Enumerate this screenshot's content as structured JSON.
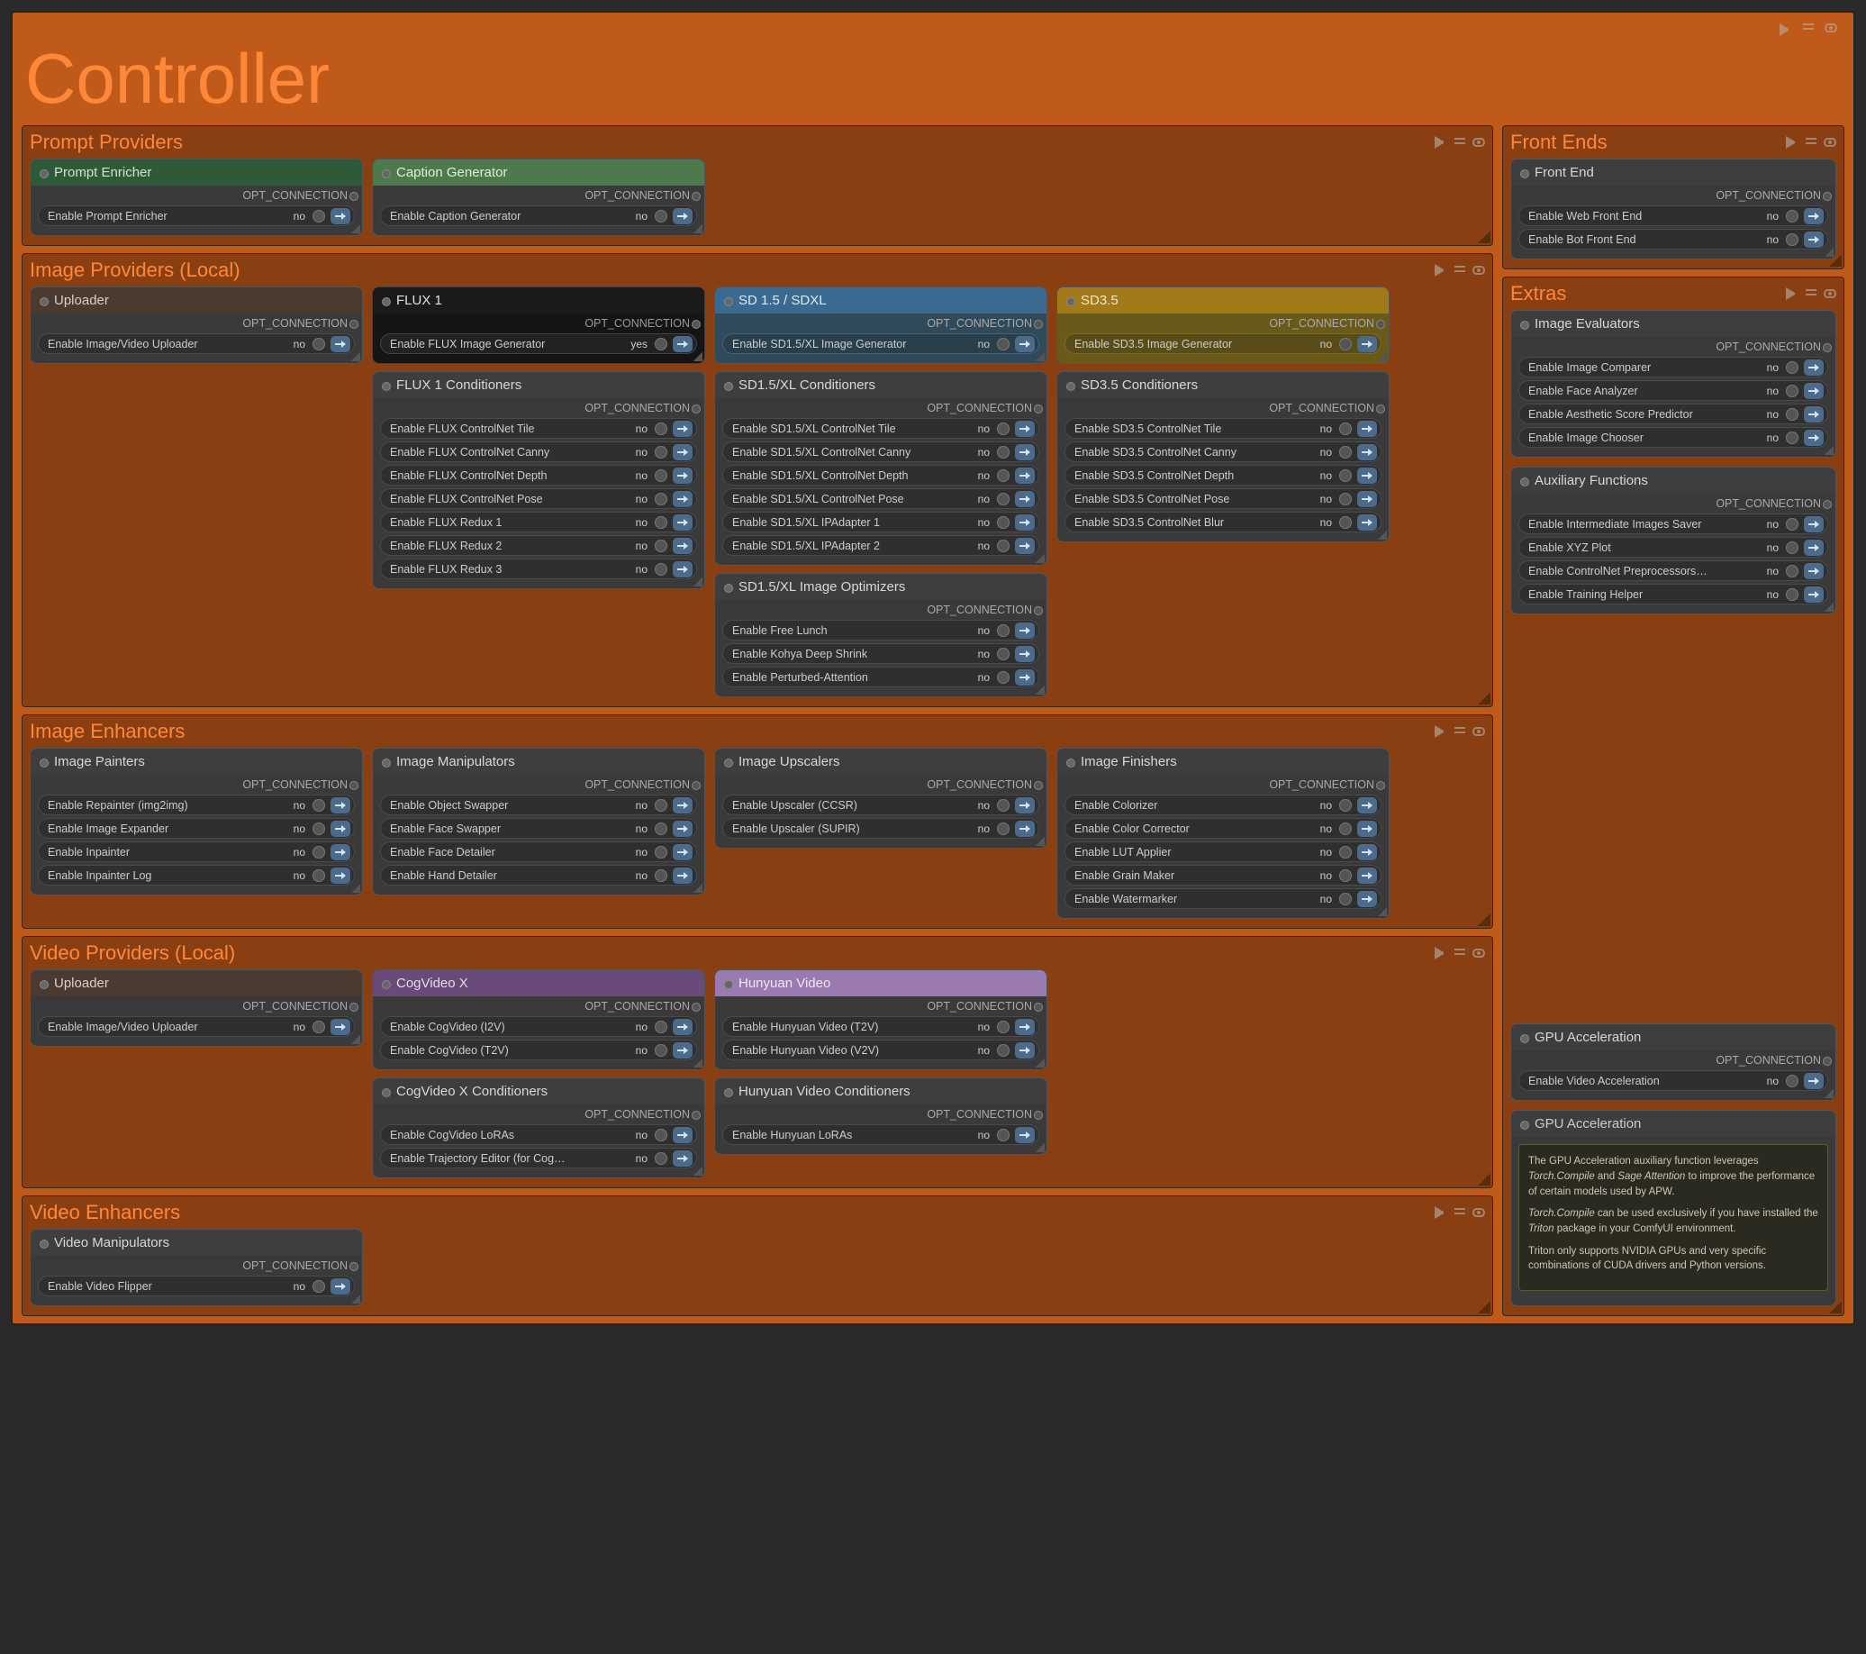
{
  "title": "Controller",
  "opt_label": "OPT_CONNECTION",
  "val_no": "no",
  "val_yes": "yes",
  "sections": {
    "prompt_providers": "Prompt Providers",
    "image_providers": "Image Providers (Local)",
    "image_enhancers": "Image Enhancers",
    "video_providers": "Video Providers (Local)",
    "video_enhancers": "Video Enhancers",
    "front_ends": "Front Ends",
    "extras": "Extras"
  },
  "nodes": {
    "prompt_enricher": {
      "title": "Prompt Enricher",
      "items": [
        {
          "label": "Enable Prompt Enricher",
          "val": "no"
        }
      ]
    },
    "caption_generator": {
      "title": "Caption Generator",
      "items": [
        {
          "label": "Enable Caption Generator",
          "val": "no"
        }
      ]
    },
    "uploader1": {
      "title": "Uploader",
      "items": [
        {
          "label": "Enable Image/Video Uploader",
          "val": "no"
        }
      ]
    },
    "flux1": {
      "title": "FLUX 1",
      "items": [
        {
          "label": "Enable FLUX Image Generator",
          "val": "yes"
        }
      ]
    },
    "flux1_cond": {
      "title": "FLUX 1 Conditioners",
      "items": [
        {
          "label": "Enable FLUX ControlNet Tile",
          "val": "no"
        },
        {
          "label": "Enable FLUX ControlNet Canny",
          "val": "no"
        },
        {
          "label": "Enable FLUX ControlNet Depth",
          "val": "no"
        },
        {
          "label": "Enable FLUX ControlNet Pose",
          "val": "no"
        },
        {
          "label": "Enable FLUX Redux 1",
          "val": "no"
        },
        {
          "label": "Enable FLUX Redux 2",
          "val": "no"
        },
        {
          "label": "Enable FLUX Redux 3",
          "val": "no"
        }
      ]
    },
    "sd15": {
      "title": "SD 1.5 / SDXL",
      "items": [
        {
          "label": "Enable SD1.5/XL Image Generator",
          "val": "no"
        }
      ]
    },
    "sd15_cond": {
      "title": "SD1.5/XL Conditioners",
      "items": [
        {
          "label": "Enable SD1.5/XL ControlNet Tile",
          "val": "no"
        },
        {
          "label": "Enable SD1.5/XL ControlNet Canny",
          "val": "no"
        },
        {
          "label": "Enable SD1.5/XL ControlNet Depth",
          "val": "no"
        },
        {
          "label": "Enable SD1.5/XL ControlNet Pose",
          "val": "no"
        },
        {
          "label": "Enable SD1.5/XL IPAdapter 1",
          "val": "no"
        },
        {
          "label": "Enable SD1.5/XL IPAdapter 2",
          "val": "no"
        }
      ]
    },
    "sd15_opt": {
      "title": "SD1.5/XL Image Optimizers",
      "items": [
        {
          "label": "Enable Free Lunch",
          "val": "no"
        },
        {
          "label": "Enable Kohya Deep Shrink",
          "val": "no"
        },
        {
          "label": "Enable Perturbed-Attention",
          "val": "no"
        }
      ]
    },
    "sd35": {
      "title": "SD3.5",
      "items": [
        {
          "label": "Enable SD3.5 Image Generator",
          "val": "no"
        }
      ]
    },
    "sd35_cond": {
      "title": "SD3.5 Conditioners",
      "items": [
        {
          "label": "Enable SD3.5 ControlNet Tile",
          "val": "no"
        },
        {
          "label": "Enable SD3.5 ControlNet Canny",
          "val": "no"
        },
        {
          "label": "Enable SD3.5 ControlNet Depth",
          "val": "no"
        },
        {
          "label": "Enable SD3.5 ControlNet Pose",
          "val": "no"
        },
        {
          "label": "Enable SD3.5 ControlNet Blur",
          "val": "no"
        }
      ]
    },
    "image_painters": {
      "title": "Image Painters",
      "items": [
        {
          "label": "Enable Repainter (img2img)",
          "val": "no"
        },
        {
          "label": "Enable Image Expander",
          "val": "no"
        },
        {
          "label": "Enable Inpainter",
          "val": "no"
        },
        {
          "label": "Enable Inpainter Log",
          "val": "no"
        }
      ]
    },
    "image_manipulators": {
      "title": "Image Manipulators",
      "items": [
        {
          "label": "Enable Object Swapper",
          "val": "no"
        },
        {
          "label": "Enable Face Swapper",
          "val": "no"
        },
        {
          "label": "Enable Face Detailer",
          "val": "no"
        },
        {
          "label": "Enable Hand Detailer",
          "val": "no"
        }
      ]
    },
    "image_upscalers": {
      "title": "Image Upscalers",
      "items": [
        {
          "label": "Enable Upscaler (CCSR)",
          "val": "no"
        },
        {
          "label": "Enable Upscaler (SUPIR)",
          "val": "no"
        }
      ]
    },
    "image_finishers": {
      "title": "Image Finishers",
      "items": [
        {
          "label": "Enable Colorizer",
          "val": "no"
        },
        {
          "label": "Enable Color Corrector",
          "val": "no"
        },
        {
          "label": "Enable LUT Applier",
          "val": "no"
        },
        {
          "label": "Enable Grain Maker",
          "val": "no"
        },
        {
          "label": "Enable Watermarker",
          "val": "no"
        }
      ]
    },
    "uploader2": {
      "title": "Uploader",
      "items": [
        {
          "label": "Enable Image/Video Uploader",
          "val": "no"
        }
      ]
    },
    "cogvideo": {
      "title": "CogVideo X",
      "items": [
        {
          "label": "Enable CogVideo (I2V)",
          "val": "no"
        },
        {
          "label": "Enable CogVideo (T2V)",
          "val": "no"
        }
      ]
    },
    "cogvideo_cond": {
      "title": "CogVideo X Conditioners",
      "items": [
        {
          "label": "Enable CogVideo LoRAs",
          "val": "no"
        },
        {
          "label": "Enable Trajectory Editor (for Cog…",
          "val": "no"
        }
      ]
    },
    "hunyuan": {
      "title": "Hunyuan Video",
      "items": [
        {
          "label": "Enable Hunyuan Video (T2V)",
          "val": "no"
        },
        {
          "label": "Enable Hunyuan Video (V2V)",
          "val": "no"
        }
      ]
    },
    "hunyuan_cond": {
      "title": "Hunyuan Video Conditioners",
      "items": [
        {
          "label": "Enable Hunyuan LoRAs",
          "val": "no"
        }
      ]
    },
    "video_manipulators": {
      "title": "Video Manipulators",
      "items": [
        {
          "label": "Enable Video Flipper",
          "val": "no"
        }
      ]
    },
    "front_end": {
      "title": "Front End",
      "items": [
        {
          "label": "Enable Web Front End",
          "val": "no"
        },
        {
          "label": "Enable Bot Front End",
          "val": "no"
        }
      ]
    },
    "image_evaluators": {
      "title": "Image Evaluators",
      "items": [
        {
          "label": "Enable Image Comparer",
          "val": "no"
        },
        {
          "label": "Enable Face Analyzer",
          "val": "no"
        },
        {
          "label": "Enable Aesthetic Score Predictor",
          "val": "no"
        },
        {
          "label": "Enable Image Chooser",
          "val": "no"
        }
      ]
    },
    "aux_functions": {
      "title": "Auxiliary Functions",
      "items": [
        {
          "label": "Enable Intermediate Images Saver",
          "val": "no"
        },
        {
          "label": "Enable XYZ Plot",
          "val": "no"
        },
        {
          "label": "Enable ControlNet Preprocessors…",
          "val": "no"
        },
        {
          "label": "Enable Training Helper",
          "val": "no"
        }
      ]
    },
    "gpu_accel": {
      "title": "GPU Acceleration",
      "items": [
        {
          "label": "Enable Video Acceleration",
          "val": "no"
        }
      ]
    },
    "gpu_info": {
      "title": "GPU Acceleration",
      "p1a": "The GPU Acceleration auxiliary function leverages ",
      "p1b": "Torch.Compile",
      "p1c": " and ",
      "p1d": "Sage Attention",
      "p1e": " to improve the performance of certain models used by APW.",
      "p2a": "Torch.Compile",
      "p2b": " can be used exclusively if you have installed the ",
      "p2c": "Triton",
      "p2d": " package in your ComfyUI environment.",
      "p3": "Triton only supports NVIDIA GPUs and very specific combinations of CUDA drivers and Python versions."
    }
  }
}
